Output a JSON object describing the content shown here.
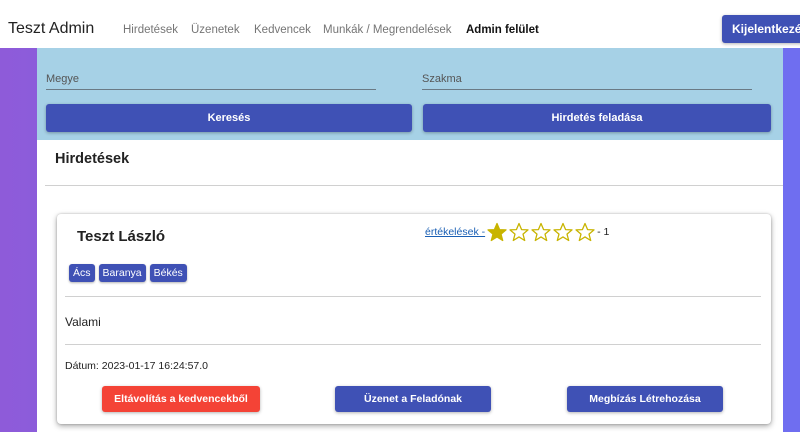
{
  "navbar": {
    "brand": "Teszt Admin",
    "items": [
      {
        "label": "Hirdetések"
      },
      {
        "label": "Üzenetek"
      },
      {
        "label": "Kedvencek"
      },
      {
        "label": "Munkák / Megrendelések"
      },
      {
        "label": "Admin felület",
        "active": true
      }
    ],
    "logout_label": "Kijelentkezés"
  },
  "search": {
    "county_label": "Megye",
    "profession_label": "Szakma",
    "search_button": "Keresés",
    "post_ad_button": "Hirdetés feladása"
  },
  "section": {
    "title": "Hirdetések"
  },
  "card": {
    "name": "Teszt László",
    "rating_link": "értékelések -",
    "rating_value": 1,
    "rating_max": 5,
    "rating_count": "- 1",
    "tags": [
      "Ács",
      "Baranya",
      "Békés"
    ],
    "description": "Valami",
    "date": "Dátum: 2023-01-17 16:24:57.0",
    "remove_favorite_button": "Eltávolítás a kedvencekből",
    "message_button": "Üzenet a Feladónak",
    "create_job_button": "Megbízás Létrehozása"
  },
  "colors": {
    "primary": "#3f51b5",
    "danger": "#f44336",
    "search_bg": "#a6d1e6",
    "star": "#c8b400"
  }
}
